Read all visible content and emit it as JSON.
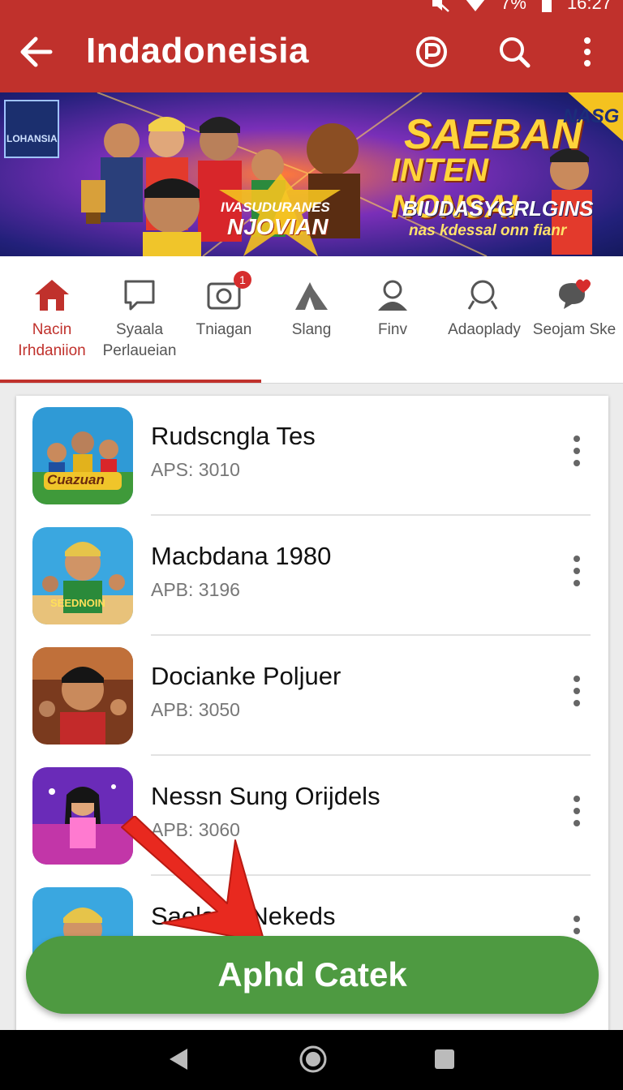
{
  "status_bar": {
    "battery": "7%",
    "time": "16:27",
    "icons": [
      "mute-icon",
      "wifi-icon",
      "battery-icon"
    ]
  },
  "app_bar": {
    "title": "Indadoneisia",
    "icons": [
      "back-arrow-icon",
      "parking-icon",
      "search-icon",
      "more-vert-icon"
    ]
  },
  "banner": {
    "headline_1": "SAEBAN",
    "headline_2": "INTEN NONSAI",
    "subline_1": "BIUDASYGRLGINS",
    "subline_2": "nas kdessal onn fianr",
    "badge": "NASG",
    "star_text_1": "IVASUDURANES",
    "star_text_2": "NJOVIAN",
    "corner_text": "LOHANSIA"
  },
  "categories": [
    {
      "label": "Nacin Irhdaniion",
      "icon": "home-icon",
      "active": true
    },
    {
      "label": "Syaala Perlaueian",
      "icon": "chat-icon",
      "active": false
    },
    {
      "label": "Tniagan",
      "icon": "camera-icon",
      "active": false,
      "badge": "1"
    },
    {
      "label": "Slang",
      "icon": "tent-icon",
      "active": false
    },
    {
      "label": "Finv",
      "icon": "profile-icon",
      "active": false
    },
    {
      "label": "Adaoplady",
      "icon": "search-icon",
      "active": false
    },
    {
      "label": "Seojam Ske",
      "icon": "chat-heart-icon",
      "active": false
    }
  ],
  "apps": [
    {
      "name": "Rudscngla Tes",
      "sub": "APS: 3010",
      "thumb_text": "Cuazuan"
    },
    {
      "name": "Macbdana 1980",
      "sub": "APB: 3196",
      "thumb_text": "SEEDNOIN"
    },
    {
      "name": "Docianke Poljuer",
      "sub": "APB: 3050",
      "thumb_text": ""
    },
    {
      "name": "Nessn Sung Orijdels",
      "sub": "APB: 3060",
      "thumb_text": ""
    },
    {
      "name": "Saeland Nekeds",
      "sub": "",
      "thumb_text": ""
    }
  ],
  "cta": {
    "label": "Aphd Catek"
  },
  "nav": [
    "back-triangle-icon",
    "home-circle-icon",
    "recents-square-icon"
  ],
  "colors": {
    "primary": "#c0312c",
    "cta": "#4e9a41",
    "pointer": "#e8291f"
  }
}
